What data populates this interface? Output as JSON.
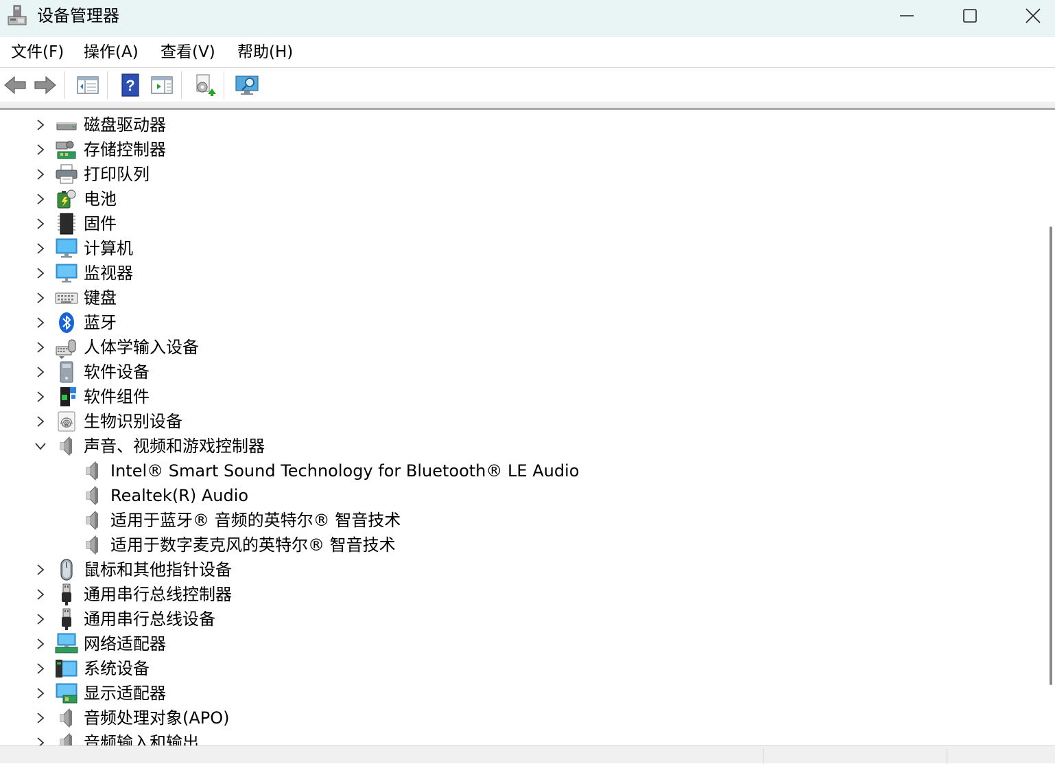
{
  "window": {
    "title": "设备管理器",
    "controls": [
      "minimize",
      "maximize",
      "close"
    ]
  },
  "menu": [
    {
      "label": "文件(F)"
    },
    {
      "label": "操作(A)"
    },
    {
      "label": "查看(V)"
    },
    {
      "label": "帮助(H)"
    }
  ],
  "toolbar": [
    {
      "name": "back-icon"
    },
    {
      "name": "forward-icon"
    },
    {
      "name": "show-hide-console-tree-icon"
    },
    {
      "name": "help-icon"
    },
    {
      "name": "show-action-pane-icon"
    },
    {
      "name": "update-driver-icon"
    },
    {
      "name": "scan-hardware-icon"
    }
  ],
  "tree": [
    {
      "label": "磁盘驱动器",
      "icon": "disk-drive-icon",
      "expanded": false
    },
    {
      "label": "存储控制器",
      "icon": "storage-controller-icon",
      "expanded": false
    },
    {
      "label": "打印队列",
      "icon": "printer-icon",
      "expanded": false
    },
    {
      "label": "电池",
      "icon": "battery-icon",
      "expanded": false
    },
    {
      "label": "固件",
      "icon": "firmware-chip-icon",
      "expanded": false
    },
    {
      "label": "计算机",
      "icon": "computer-icon",
      "expanded": false
    },
    {
      "label": "监视器",
      "icon": "monitor-icon",
      "expanded": false
    },
    {
      "label": "键盘",
      "icon": "keyboard-icon",
      "expanded": false
    },
    {
      "label": "蓝牙",
      "icon": "bluetooth-icon",
      "expanded": false
    },
    {
      "label": "人体学输入设备",
      "icon": "hid-icon",
      "expanded": false
    },
    {
      "label": "软件设备",
      "icon": "software-device-icon",
      "expanded": false
    },
    {
      "label": "软件组件",
      "icon": "software-component-icon",
      "expanded": false
    },
    {
      "label": "生物识别设备",
      "icon": "fingerprint-icon",
      "expanded": false
    },
    {
      "label": "声音、视频和游戏控制器",
      "icon": "speaker-icon",
      "expanded": true,
      "children": [
        {
          "label": "Intel® Smart Sound Technology for Bluetooth® LE Audio",
          "icon": "speaker-icon"
        },
        {
          "label": "Realtek(R) Audio",
          "icon": "speaker-icon"
        },
        {
          "label": "适用于蓝牙® 音频的英特尔® 智音技术",
          "icon": "speaker-icon"
        },
        {
          "label": "适用于数字麦克风的英特尔® 智音技术",
          "icon": "speaker-icon"
        }
      ]
    },
    {
      "label": "鼠标和其他指针设备",
      "icon": "mouse-icon",
      "expanded": false
    },
    {
      "label": "通用串行总线控制器",
      "icon": "usb-icon",
      "expanded": false
    },
    {
      "label": "通用串行总线设备",
      "icon": "usb-icon",
      "expanded": false
    },
    {
      "label": "网络适配器",
      "icon": "network-adapter-icon",
      "expanded": false
    },
    {
      "label": "系统设备",
      "icon": "system-device-icon",
      "expanded": false
    },
    {
      "label": "显示适配器",
      "icon": "display-adapter-icon",
      "expanded": false
    },
    {
      "label": "音频处理对象(APO)",
      "icon": "speaker-icon",
      "expanded": false
    },
    {
      "label": "音频输入和输出",
      "icon": "speaker-icon",
      "expanded": false
    }
  ]
}
